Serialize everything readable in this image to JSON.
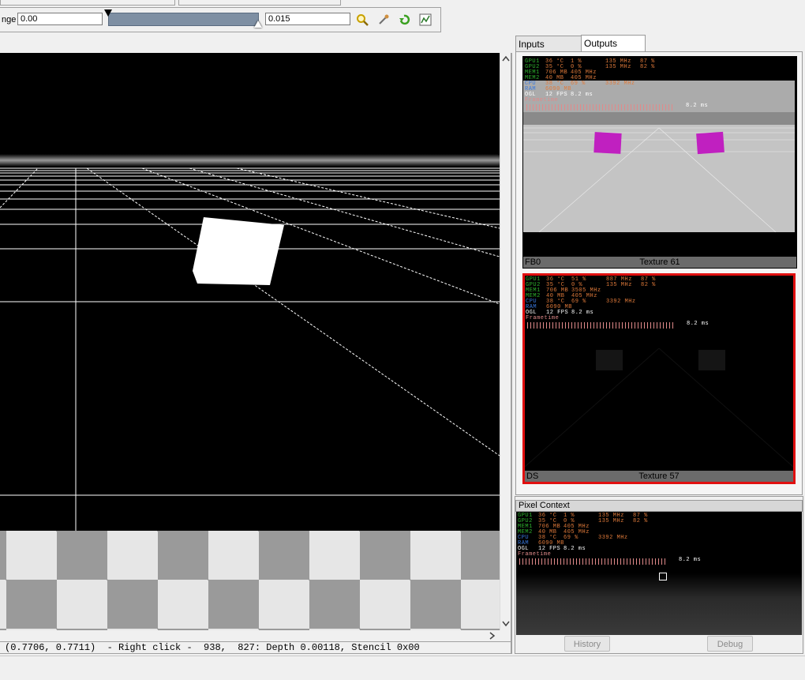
{
  "toolbar": {
    "range_label": "nge",
    "min_value": "0.00",
    "max_value": "0.015"
  },
  "icons": {
    "zoom": "magnifier-icon",
    "pick": "eyedropper-icon",
    "reset": "undo-arrow-icon",
    "histogram": "histogram-icon"
  },
  "status": {
    "text": "(0.7706, 0.7711)  - Right click -  938,  827: Depth 0.00118, Stencil 0x00"
  },
  "tabs": [
    {
      "label": "Inputs",
      "active": false
    },
    {
      "label": "Outputs",
      "active": true
    }
  ],
  "thumbnails": [
    {
      "left_label": "FB0",
      "center_label": "Texture 61",
      "selected": false
    },
    {
      "left_label": "DS",
      "center_label": "Texture 57",
      "selected": true
    }
  ],
  "hud1": {
    "rows": [
      {
        "label": "GPU1",
        "a": "36 °C",
        "b": "1 %",
        "c": "135 MHz",
        "d": "87 %"
      },
      {
        "label": "GPU2",
        "a": "35 °C",
        "b": "0 %",
        "c": "135 MHz",
        "d": "82 %"
      },
      {
        "label": "MEM1",
        "a": "706 MB",
        "b": "405 MHz",
        "c": "",
        "d": ""
      },
      {
        "label": "MEM2",
        "a": "40 MB",
        "b": "405 MHz",
        "c": "",
        "d": ""
      },
      {
        "label": "CPU",
        "a": "38 °C",
        "b": "69 %",
        "c": "3392 MHz",
        "d": ""
      },
      {
        "label": "RAM",
        "a": "6090 MB",
        "b": "",
        "c": "",
        "d": ""
      },
      {
        "label": "OGL",
        "a": "12 FPS",
        "b": "8.2 ms",
        "c": "",
        "d": ""
      }
    ],
    "frametime_label": "Frametime",
    "frametime_value": "8.2 ms"
  },
  "hud2": {
    "rows": [
      {
        "label": "GPU1",
        "a": "36 °C",
        "b": "51 %",
        "c": "887 MHz",
        "d": "87 %"
      },
      {
        "label": "GPU2",
        "a": "35 °C",
        "b": "0 %",
        "c": "135 MHz",
        "d": "82 %"
      },
      {
        "label": "MEM1",
        "a": "706 MB",
        "b": "3505 MHz",
        "c": "",
        "d": ""
      },
      {
        "label": "MEM2",
        "a": "40 MB",
        "b": "405 MHz",
        "c": "",
        "d": ""
      },
      {
        "label": "CPU",
        "a": "38 °C",
        "b": "69 %",
        "c": "3392 MHz",
        "d": ""
      },
      {
        "label": "RAM",
        "a": "6090 MB",
        "b": "",
        "c": "",
        "d": ""
      },
      {
        "label": "OGL",
        "a": "12 FPS",
        "b": "8.2 ms",
        "c": "",
        "d": ""
      }
    ],
    "frametime_label": "Frametime",
    "frametime_value": "8.2 ms"
  },
  "hud3": {
    "rows": [
      {
        "label": "GPU1",
        "a": "36 °C",
        "b": "1 %",
        "c": "135 MHz",
        "d": "87 %"
      },
      {
        "label": "GPU2",
        "a": "35 °C",
        "b": "0 %",
        "c": "135 MHz",
        "d": "82 %"
      },
      {
        "label": "MEM1",
        "a": "706 MB",
        "b": "405 MHz",
        "c": "",
        "d": ""
      },
      {
        "label": "MEM2",
        "a": "40 MB",
        "b": "405 MHz",
        "c": "",
        "d": ""
      },
      {
        "label": "CPU",
        "a": "38 °C",
        "b": "69 %",
        "c": "3392 MHz",
        "d": ""
      },
      {
        "label": "RAM",
        "a": "6090 MB",
        "b": "",
        "c": "",
        "d": ""
      },
      {
        "label": "OGL",
        "a": "12 FPS",
        "b": "8.2 ms",
        "c": "",
        "d": ""
      }
    ],
    "frametime_label": "Frametime",
    "frametime_value": "8.2 ms"
  },
  "pixel_context": {
    "title": "Pixel Context",
    "history_button": "History",
    "debug_button": "Debug"
  },
  "colors": {
    "selection_border": "#e01010",
    "hud_green": "#2fb52f",
    "hud_orange": "#e07a3a",
    "hud_blue": "#3a7ae0",
    "hud_pink": "#e08a8a",
    "magenta_cube": "#c020c0"
  }
}
